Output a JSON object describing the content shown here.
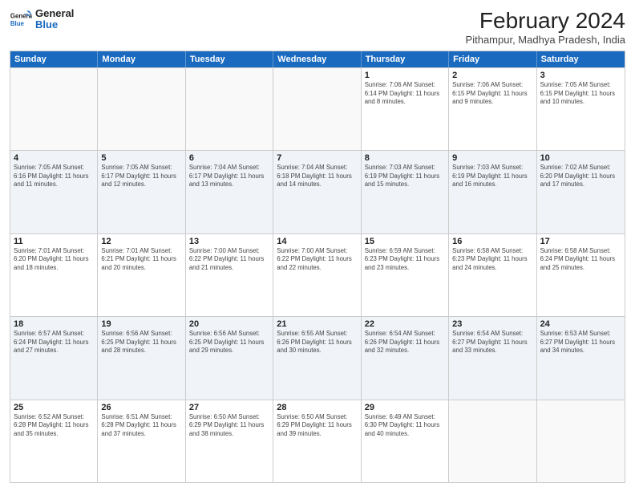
{
  "header": {
    "logo_line1": "General",
    "logo_line2": "Blue",
    "month_year": "February 2024",
    "location": "Pithampur, Madhya Pradesh, India"
  },
  "days_of_week": [
    "Sunday",
    "Monday",
    "Tuesday",
    "Wednesday",
    "Thursday",
    "Friday",
    "Saturday"
  ],
  "rows": [
    {
      "cells": [
        {
          "day": "",
          "info": ""
        },
        {
          "day": "",
          "info": ""
        },
        {
          "day": "",
          "info": ""
        },
        {
          "day": "",
          "info": ""
        },
        {
          "day": "1",
          "info": "Sunrise: 7:06 AM\nSunset: 6:14 PM\nDaylight: 11 hours\nand 8 minutes."
        },
        {
          "day": "2",
          "info": "Sunrise: 7:06 AM\nSunset: 6:15 PM\nDaylight: 11 hours\nand 9 minutes."
        },
        {
          "day": "3",
          "info": "Sunrise: 7:05 AM\nSunset: 6:15 PM\nDaylight: 11 hours\nand 10 minutes."
        }
      ]
    },
    {
      "cells": [
        {
          "day": "4",
          "info": "Sunrise: 7:05 AM\nSunset: 6:16 PM\nDaylight: 11 hours\nand 11 minutes."
        },
        {
          "day": "5",
          "info": "Sunrise: 7:05 AM\nSunset: 6:17 PM\nDaylight: 11 hours\nand 12 minutes."
        },
        {
          "day": "6",
          "info": "Sunrise: 7:04 AM\nSunset: 6:17 PM\nDaylight: 11 hours\nand 13 minutes."
        },
        {
          "day": "7",
          "info": "Sunrise: 7:04 AM\nSunset: 6:18 PM\nDaylight: 11 hours\nand 14 minutes."
        },
        {
          "day": "8",
          "info": "Sunrise: 7:03 AM\nSunset: 6:19 PM\nDaylight: 11 hours\nand 15 minutes."
        },
        {
          "day": "9",
          "info": "Sunrise: 7:03 AM\nSunset: 6:19 PM\nDaylight: 11 hours\nand 16 minutes."
        },
        {
          "day": "10",
          "info": "Sunrise: 7:02 AM\nSunset: 6:20 PM\nDaylight: 11 hours\nand 17 minutes."
        }
      ]
    },
    {
      "cells": [
        {
          "day": "11",
          "info": "Sunrise: 7:01 AM\nSunset: 6:20 PM\nDaylight: 11 hours\nand 18 minutes."
        },
        {
          "day": "12",
          "info": "Sunrise: 7:01 AM\nSunset: 6:21 PM\nDaylight: 11 hours\nand 20 minutes."
        },
        {
          "day": "13",
          "info": "Sunrise: 7:00 AM\nSunset: 6:22 PM\nDaylight: 11 hours\nand 21 minutes."
        },
        {
          "day": "14",
          "info": "Sunrise: 7:00 AM\nSunset: 6:22 PM\nDaylight: 11 hours\nand 22 minutes."
        },
        {
          "day": "15",
          "info": "Sunrise: 6:59 AM\nSunset: 6:23 PM\nDaylight: 11 hours\nand 23 minutes."
        },
        {
          "day": "16",
          "info": "Sunrise: 6:58 AM\nSunset: 6:23 PM\nDaylight: 11 hours\nand 24 minutes."
        },
        {
          "day": "17",
          "info": "Sunrise: 6:58 AM\nSunset: 6:24 PM\nDaylight: 11 hours\nand 25 minutes."
        }
      ]
    },
    {
      "cells": [
        {
          "day": "18",
          "info": "Sunrise: 6:57 AM\nSunset: 6:24 PM\nDaylight: 11 hours\nand 27 minutes."
        },
        {
          "day": "19",
          "info": "Sunrise: 6:56 AM\nSunset: 6:25 PM\nDaylight: 11 hours\nand 28 minutes."
        },
        {
          "day": "20",
          "info": "Sunrise: 6:56 AM\nSunset: 6:25 PM\nDaylight: 11 hours\nand 29 minutes."
        },
        {
          "day": "21",
          "info": "Sunrise: 6:55 AM\nSunset: 6:26 PM\nDaylight: 11 hours\nand 30 minutes."
        },
        {
          "day": "22",
          "info": "Sunrise: 6:54 AM\nSunset: 6:26 PM\nDaylight: 11 hours\nand 32 minutes."
        },
        {
          "day": "23",
          "info": "Sunrise: 6:54 AM\nSunset: 6:27 PM\nDaylight: 11 hours\nand 33 minutes."
        },
        {
          "day": "24",
          "info": "Sunrise: 6:53 AM\nSunset: 6:27 PM\nDaylight: 11 hours\nand 34 minutes."
        }
      ]
    },
    {
      "cells": [
        {
          "day": "25",
          "info": "Sunrise: 6:52 AM\nSunset: 6:28 PM\nDaylight: 11 hours\nand 35 minutes."
        },
        {
          "day": "26",
          "info": "Sunrise: 6:51 AM\nSunset: 6:28 PM\nDaylight: 11 hours\nand 37 minutes."
        },
        {
          "day": "27",
          "info": "Sunrise: 6:50 AM\nSunset: 6:29 PM\nDaylight: 11 hours\nand 38 minutes."
        },
        {
          "day": "28",
          "info": "Sunrise: 6:50 AM\nSunset: 6:29 PM\nDaylight: 11 hours\nand 39 minutes."
        },
        {
          "day": "29",
          "info": "Sunrise: 6:49 AM\nSunset: 6:30 PM\nDaylight: 11 hours\nand 40 minutes."
        },
        {
          "day": "",
          "info": ""
        },
        {
          "day": "",
          "info": ""
        }
      ]
    }
  ]
}
